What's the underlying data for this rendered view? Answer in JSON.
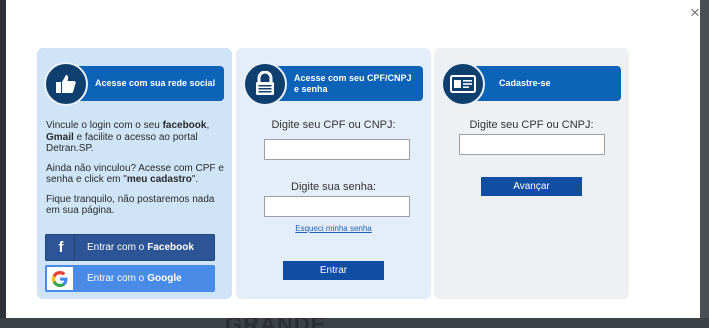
{
  "modal": {
    "close_label": "×"
  },
  "background": {
    "text": "GRANDE"
  },
  "social": {
    "header": "Acesse com sua rede social",
    "icon": "thumbs-up-icon",
    "text": {
      "p1_a": "Vincule o login com o seu",
      "p1_facebook": "facebook",
      "p1_comma": ", ",
      "p1_gmail": "Gmail",
      "p1_b": " e facilite o acesso ao portal Detran.SP.",
      "p2_a": "Ainda não vinculou? Acesse com CPF e senha e click em \"",
      "p2_bold": "meu cadastro",
      "p2_b": "\".",
      "p3": "Fique tranquilo, não postaremos nada em sua página."
    },
    "facebook_button": {
      "prefix": "Entrar com o",
      "brand": "Facebook"
    },
    "google_button": {
      "prefix": "Entrar com o",
      "brand": "Google"
    }
  },
  "login": {
    "header": "Acesse com seu CPF/CNPJ e senha",
    "icon": "padlock-icon",
    "cpf_label": "Digite seu CPF ou CNPJ:",
    "cpf_value": "",
    "password_label": "Digite sua senha:",
    "password_value": "",
    "forgot_link": "Esqueci minha senha",
    "submit_label": "Entrar"
  },
  "register": {
    "header": "Cadastre-se",
    "icon": "id-card-icon",
    "cpf_label": "Digite seu CPF ou CNPJ:",
    "cpf_value": "",
    "submit_label": "Avançar"
  },
  "colors": {
    "header_blue": "#0c63b8",
    "facebook": "#2d5494",
    "google": "#4a8be8",
    "primary_button": "#0f4ea3"
  }
}
